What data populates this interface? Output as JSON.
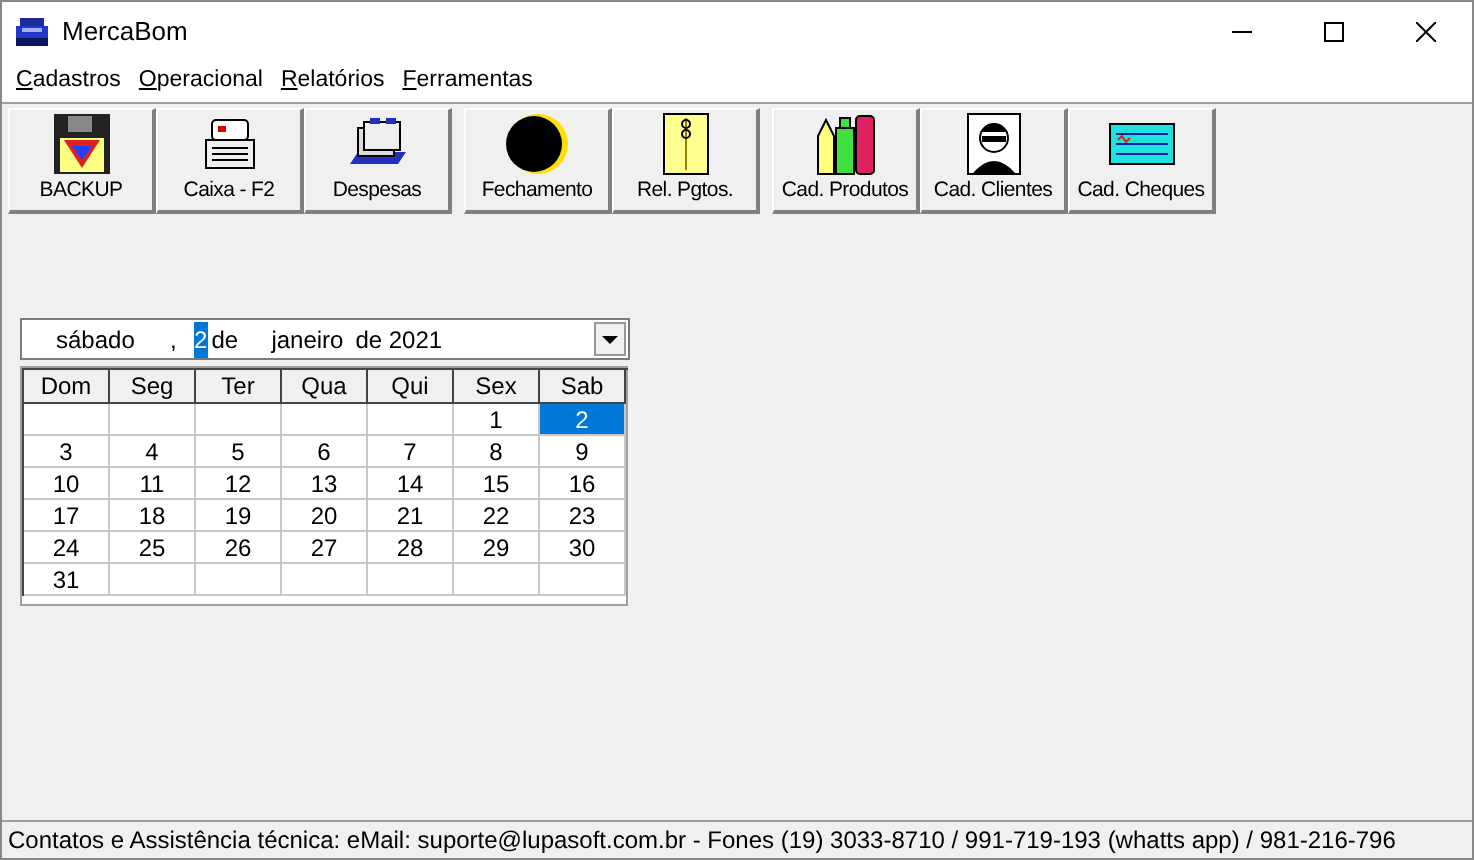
{
  "window": {
    "title": "MercaBom"
  },
  "menu": [
    {
      "label": "Cadastros"
    },
    {
      "label": "Operacional"
    },
    {
      "label": "Relatórios"
    },
    {
      "label": "Ferramentas"
    }
  ],
  "toolbar": [
    [
      {
        "label": "BACKUP",
        "kind": "floppy"
      },
      {
        "label": "Caixa - F2",
        "kind": "register"
      },
      {
        "label": "Despesas",
        "kind": "files"
      }
    ],
    [
      {
        "label": "Fechamento",
        "kind": "moon"
      },
      {
        "label": "Rel. Pgtos.",
        "kind": "envelope"
      }
    ],
    [
      {
        "label": "Cad. Produtos",
        "kind": "pencils"
      },
      {
        "label": "Cad. Clientes",
        "kind": "person"
      },
      {
        "label": "Cad. Cheques",
        "kind": "cheque"
      }
    ]
  ],
  "date_picker": {
    "weekday": "sábado",
    "separator": ",",
    "day": "2",
    "day_selected": true,
    "de1": "de",
    "month": "janeiro",
    "year": "de 2021"
  },
  "calendar": {
    "headers": [
      "Dom",
      "Seg",
      "Ter",
      "Qua",
      "Qui",
      "Sex",
      "Sab"
    ],
    "weeks": [
      [
        {
          "kind": "blank"
        },
        {
          "kind": "blank"
        },
        {
          "kind": "blank"
        },
        {
          "kind": "blank"
        },
        {
          "kind": "blank"
        },
        {
          "kind": "day",
          "day": "1",
          "selected": false
        },
        {
          "kind": "day",
          "day": "2",
          "selected": true
        }
      ],
      [
        {
          "kind": "day",
          "day": "3",
          "selected": false
        },
        {
          "kind": "day",
          "day": "4",
          "selected": false
        },
        {
          "kind": "day",
          "day": "5",
          "selected": false
        },
        {
          "kind": "day",
          "day": "6",
          "selected": false
        },
        {
          "kind": "day",
          "day": "7",
          "selected": false
        },
        {
          "kind": "day",
          "day": "8",
          "selected": false
        },
        {
          "kind": "day",
          "day": "9",
          "selected": false
        }
      ],
      [
        {
          "kind": "day",
          "day": "10",
          "selected": false
        },
        {
          "kind": "day",
          "day": "11",
          "selected": false
        },
        {
          "kind": "day",
          "day": "12",
          "selected": false
        },
        {
          "kind": "day",
          "day": "13",
          "selected": false
        },
        {
          "kind": "day",
          "day": "14",
          "selected": false
        },
        {
          "kind": "day",
          "day": "15",
          "selected": false
        },
        {
          "kind": "day",
          "day": "16",
          "selected": false
        }
      ],
      [
        {
          "kind": "day",
          "day": "17",
          "selected": false
        },
        {
          "kind": "day",
          "day": "18",
          "selected": false
        },
        {
          "kind": "day",
          "day": "19",
          "selected": false
        },
        {
          "kind": "day",
          "day": "20",
          "selected": false
        },
        {
          "kind": "day",
          "day": "21",
          "selected": false
        },
        {
          "kind": "day",
          "day": "22",
          "selected": false
        },
        {
          "kind": "day",
          "day": "23",
          "selected": false
        }
      ],
      [
        {
          "kind": "day",
          "day": "24",
          "selected": false
        },
        {
          "kind": "day",
          "day": "25",
          "selected": false
        },
        {
          "kind": "day",
          "day": "26",
          "selected": false
        },
        {
          "kind": "day",
          "day": "27",
          "selected": false
        },
        {
          "kind": "day",
          "day": "28",
          "selected": false
        },
        {
          "kind": "day",
          "day": "29",
          "selected": false
        },
        {
          "kind": "day",
          "day": "30",
          "selected": false
        }
      ],
      [
        {
          "kind": "day",
          "day": "31",
          "selected": false
        },
        {
          "kind": "blank"
        },
        {
          "kind": "blank"
        },
        {
          "kind": "blank"
        },
        {
          "kind": "blank"
        },
        {
          "kind": "blank"
        },
        {
          "kind": "blank"
        }
      ]
    ]
  },
  "status_bar": "Contatos e Assistência técnica: eMail: suporte@lupasoft.com.br - Fones (19) 3033-8710 / 991-719-193 (whatts app) / 981-216-796"
}
